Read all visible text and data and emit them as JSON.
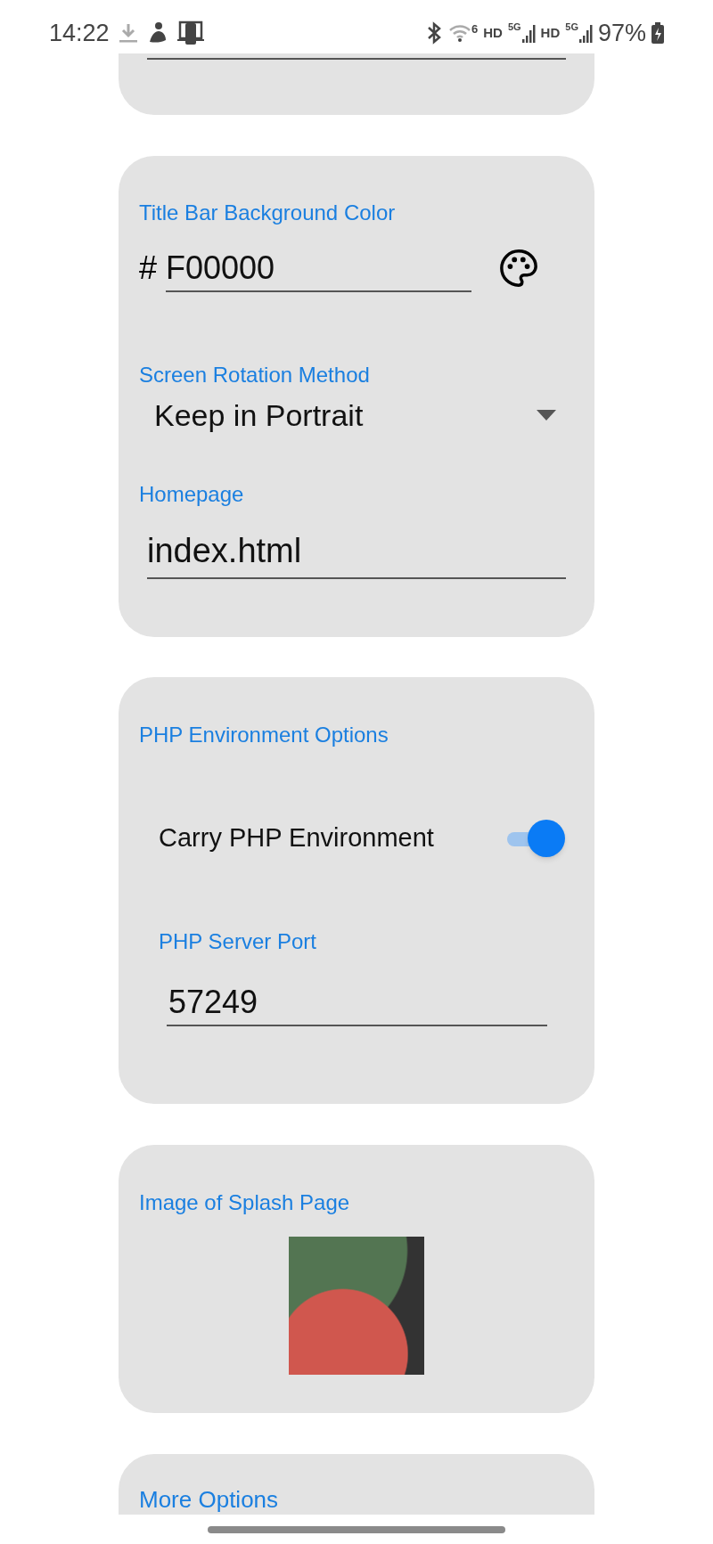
{
  "status_bar": {
    "time": "14:22",
    "wifi_label": "6",
    "network": [
      {
        "hd": "HD",
        "gen": "5G"
      },
      {
        "hd": "HD",
        "gen": "5G"
      }
    ],
    "battery": "97%"
  },
  "title_bar_color": {
    "label": "Title Bar Background Color",
    "prefix": "#",
    "value": "F00000"
  },
  "screen_rotation": {
    "label": "Screen Rotation Method",
    "value": "Keep in Portrait"
  },
  "homepage": {
    "label": "Homepage",
    "value": "index.html"
  },
  "php": {
    "title": "PHP Environment Options",
    "toggle": {
      "label": "Carry PHP Environment",
      "on": true
    },
    "port": {
      "label": "PHP Server Port",
      "value": "57249"
    }
  },
  "splash": {
    "title": "Image of Splash Page"
  },
  "more": {
    "title": "More Options"
  }
}
